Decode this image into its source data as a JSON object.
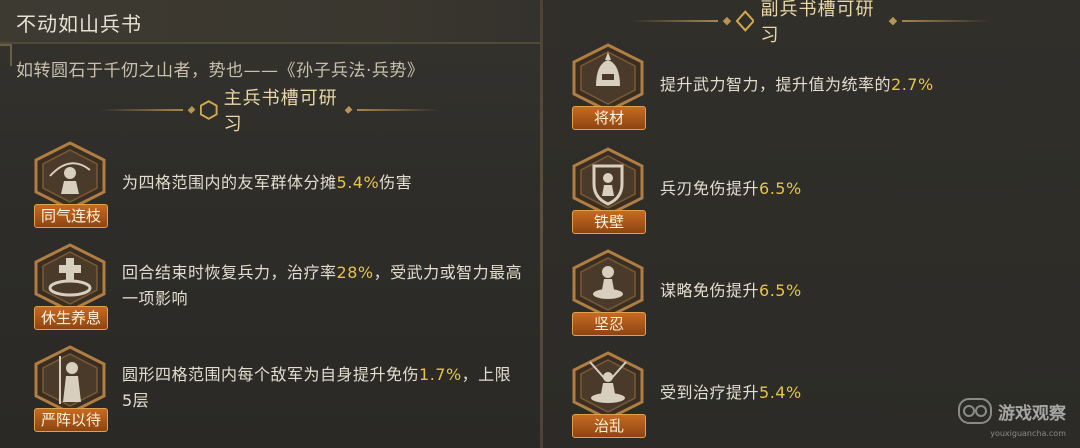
{
  "title": "不动如山兵书",
  "quote": "如转圆石于千仞之山者，势也——《孙子兵法·兵势》",
  "main_section": {
    "title": "主兵书槽可研习"
  },
  "sub_section": {
    "title": "副兵书槽可研习"
  },
  "main_skills": [
    {
      "name": "同气连枝",
      "icon": "warrior-icon",
      "desc_parts": [
        "为四格范围内的友军群体分摊",
        "5.4%",
        "伤害"
      ]
    },
    {
      "name": "休生养息",
      "icon": "heal-cross-icon",
      "desc_parts": [
        "回合结束时恢复兵力，治疗率",
        "28%",
        "，受武力或智力最高一项影响"
      ]
    },
    {
      "name": "严阵以待",
      "icon": "soldier-icon",
      "desc_parts": [
        "圆形四格范围内每个敌军为自身提升免伤",
        "1.7%",
        "，上限5层"
      ]
    }
  ],
  "sub_skills": [
    {
      "name": "将材",
      "icon": "general-helmet-icon",
      "desc_parts": [
        "提升武力智力，提升值为统率的",
        "2.7%",
        ""
      ]
    },
    {
      "name": "铁壁",
      "icon": "shield-icon",
      "desc_parts": [
        "兵刃免伤提升",
        "6.5%",
        ""
      ]
    },
    {
      "name": "坚忍",
      "icon": "meditating-figure-icon",
      "desc_parts": [
        "谋略免伤提升",
        "6.5%",
        ""
      ]
    },
    {
      "name": "治乱",
      "icon": "seated-warrior-icon",
      "desc_parts": [
        "受到治疗提升",
        "5.4%",
        ""
      ]
    }
  ],
  "watermark": {
    "text": "游戏观察",
    "sub": "youxiguancha.com"
  },
  "colors": {
    "highlight": "#e8c34a",
    "label_orange": "#c66a22",
    "gold": "#b79556"
  }
}
